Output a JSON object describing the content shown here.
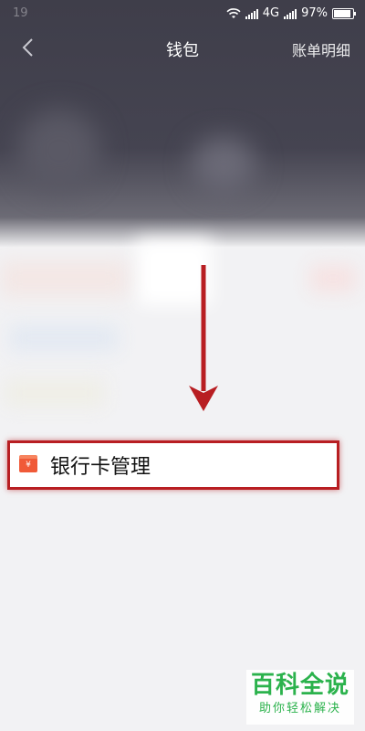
{
  "status_bar": {
    "time": "19",
    "network": "4G",
    "battery": "97%"
  },
  "nav": {
    "title": "钱包",
    "right_link": "账单明细"
  },
  "highlight": {
    "item_label": "银行卡管理",
    "icon_glyph": "¥"
  },
  "watermark": {
    "main": "百科全说",
    "sub": "助你轻松解决"
  },
  "colors": {
    "accent": "#b81e22",
    "header_bg": "#3f3e4a",
    "watermark_green": "#2bb24c"
  }
}
